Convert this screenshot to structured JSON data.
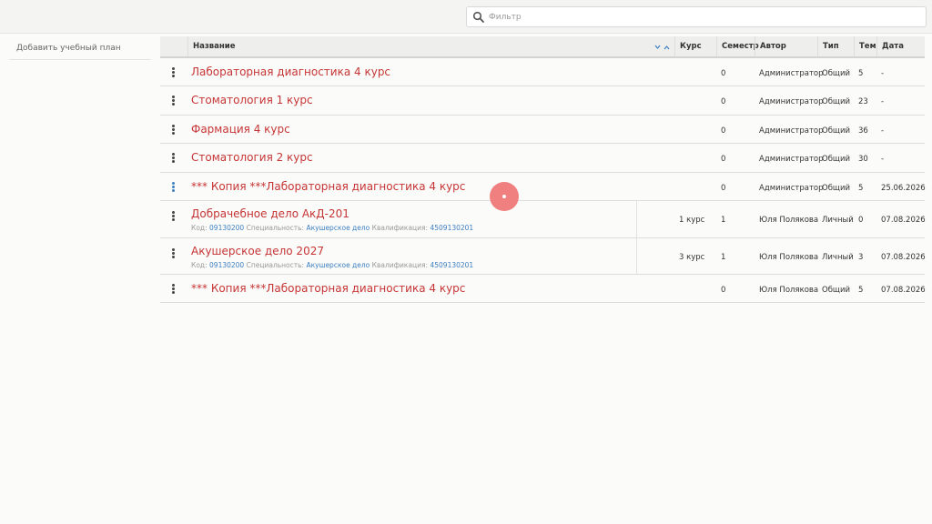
{
  "search": {
    "placeholder": "Фильтр",
    "value": ""
  },
  "sidebar": {
    "items": [
      {
        "label": "Добавить учебный план"
      }
    ]
  },
  "table": {
    "columns": {
      "name": "Название",
      "course": "Курс",
      "semester": "Семестр",
      "author": "Автор",
      "type": "Тип",
      "topics": "Тем",
      "date": "Дата"
    },
    "meta_labels": {
      "code": "Код:",
      "specialty": "Специальность:",
      "qualification": "Квалификация:"
    },
    "rows": [
      {
        "name": "Лабораторная диагностика 4 курс",
        "course": "",
        "semester": "0",
        "author": "Администратор",
        "type": "Общий",
        "topics": "5",
        "date": "-"
      },
      {
        "name": "Стоматология 1 курс",
        "course": "",
        "semester": "0",
        "author": "Администратор",
        "type": "Общий",
        "topics": "23",
        "date": "-"
      },
      {
        "name": "Фармация 4 курс",
        "course": "",
        "semester": "0",
        "author": "Администратор",
        "type": "Общий",
        "topics": "36",
        "date": "-"
      },
      {
        "name": "Стоматология 2 курс",
        "course": "",
        "semester": "0",
        "author": "Администратор",
        "type": "Общий",
        "topics": "30",
        "date": "-"
      },
      {
        "name": "*** Копия ***Лабораторная диагностика 4 курс",
        "course": "",
        "semester": "0",
        "author": "Администратор",
        "type": "Общий",
        "topics": "5",
        "date": "25.06.2026"
      },
      {
        "name": "Добрачебное дело АкД-201",
        "course": "1 курс",
        "semester": "1",
        "author": "Юля Полякова",
        "type": "Личный",
        "topics": "0",
        "date": "07.08.2026",
        "code": "09130200",
        "specialty": "Акушерское дело",
        "qualification": "4509130201"
      },
      {
        "name": "Акушерское дело 2027",
        "course": "3 курс",
        "semester": "1",
        "author": "Юля Полякова",
        "type": "Личный",
        "topics": "3",
        "date": "07.08.2026",
        "code": "09130200",
        "specialty": "Акушерское дело",
        "qualification": "4509130201"
      },
      {
        "name": "*** Копия ***Лабораторная диагностика 4 курс",
        "course": "",
        "semester": "0",
        "author": "Юля Полякова",
        "type": "Общий",
        "topics": "5",
        "date": "07.08.2026"
      }
    ]
  },
  "colors": {
    "title": "#c63535",
    "link": "#3d7fc1",
    "cursor": "#f08080"
  },
  "icons": {
    "search": "search-icon",
    "row_menu": "kebab-menu-icon",
    "sort": "sort-chevrons-icon"
  }
}
